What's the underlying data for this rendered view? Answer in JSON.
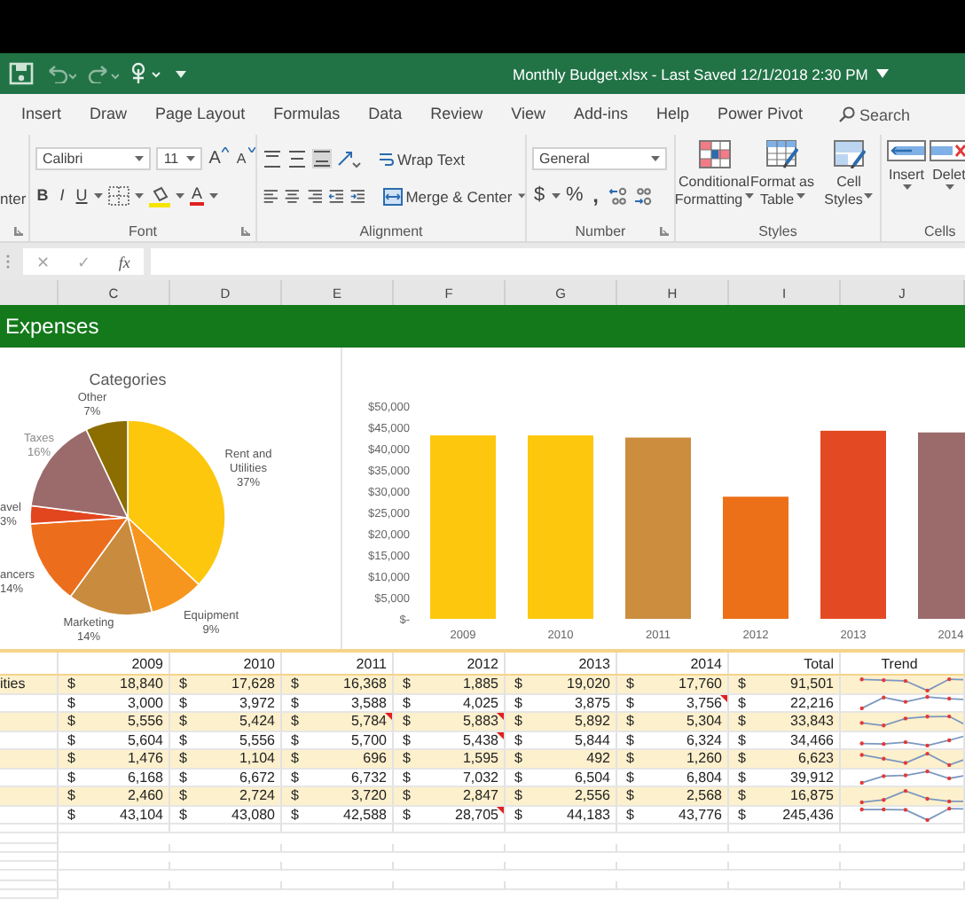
{
  "title_bar": {
    "title": "Monthly Budget.xlsx - Last Saved 12/1/2018 2:30 PM"
  },
  "tabs": [
    {
      "label": "Insert",
      "selected": false
    },
    {
      "label": "Draw",
      "selected": false
    },
    {
      "label": "Page Layout",
      "selected": false
    },
    {
      "label": "Formulas",
      "selected": false
    },
    {
      "label": "Data",
      "selected": false
    },
    {
      "label": "Review",
      "selected": false
    },
    {
      "label": "View",
      "selected": false
    },
    {
      "label": "Add-ins",
      "selected": false
    },
    {
      "label": "Help",
      "selected": false
    },
    {
      "label": "Power Pivot",
      "selected": false
    }
  ],
  "search": {
    "placeholder": "Search"
  },
  "ribbon": {
    "clipped_label": "nter",
    "font": {
      "name": "Calibri",
      "size": "11",
      "grow": "A",
      "shrink": "A",
      "bold": "B",
      "italic": "I",
      "underline": "U",
      "font_color": "A",
      "group": "Font"
    },
    "alignment": {
      "wrap": "Wrap Text",
      "merge": "Merge & Center",
      "group": "Alignment"
    },
    "number": {
      "format": "General",
      "currency": "$",
      "percent": "%",
      "comma": ",",
      "group": "Number"
    },
    "styles": {
      "buttons": [
        {
          "lines": [
            "Conditional",
            "Formatting"
          ],
          "kind": "conditional"
        },
        {
          "lines": [
            "Format as",
            "Table"
          ],
          "kind": "table"
        },
        {
          "lines": [
            "Cell",
            "Styles"
          ],
          "kind": "cellstyles"
        }
      ],
      "group": "Styles"
    },
    "cells": {
      "buttons": [
        {
          "label": "Insert",
          "kind": "insert"
        },
        {
          "label": "Delet",
          "kind": "delete"
        }
      ],
      "group": "Cells"
    }
  },
  "formula_bar": {
    "cancel": "✕",
    "enter": "✓",
    "fx": "fx"
  },
  "column_headers": [
    "C",
    "D",
    "E",
    "F",
    "G",
    "H",
    "I",
    "J"
  ],
  "banner": {
    "title": "Expenses"
  },
  "pie_chart": {
    "chart_data": {
      "type": "pie",
      "title": "Categories",
      "categories": [
        "Rent and Utilities",
        "Equipment",
        "Marketing",
        "ancers",
        "avel",
        "Taxes",
        "Other"
      ],
      "values": [
        37,
        9,
        14,
        14,
        3,
        16,
        7
      ],
      "colors": [
        "#fdc70d",
        "#f7961e",
        "#c98c3e",
        "#ec6e1c",
        "#e2461f",
        "#9b6b6b",
        "#8c6d00"
      ],
      "value_labels": [
        "37%",
        "9%",
        "14%",
        "14%",
        "3%",
        "16%",
        "7%"
      ],
      "data_labels": true
    }
  },
  "bar_chart": {
    "chart_data": {
      "type": "bar",
      "categories": [
        "2009",
        "2010",
        "2011",
        "2012",
        "2013",
        "2014"
      ],
      "values": [
        43100,
        43100,
        42600,
        28700,
        44200,
        43800
      ],
      "colors": [
        "#fdc70d",
        "#fdc70d",
        "#cc8d3f",
        "#ec7018",
        "#e34a24",
        "#9b6b6b"
      ],
      "ylim": [
        0,
        50000
      ],
      "yticks": [
        {
          "value": 0,
          "label": "$-"
        },
        {
          "value": 5000,
          "label": "$5,000"
        },
        {
          "value": 10000,
          "label": "$10,000"
        },
        {
          "value": 15000,
          "label": "$15,000"
        },
        {
          "value": 20000,
          "label": "$20,000"
        },
        {
          "value": 25000,
          "label": "$25,000"
        },
        {
          "value": 30000,
          "label": "$30,000"
        },
        {
          "value": 35000,
          "label": "$35,000"
        },
        {
          "value": 40000,
          "label": "$40,000"
        },
        {
          "value": 45000,
          "label": "$45,000"
        },
        {
          "value": 50000,
          "label": "$50,000"
        }
      ]
    }
  },
  "table": {
    "columns": [
      "2009",
      "2010",
      "2011",
      "2012",
      "2013",
      "2014",
      "Total",
      "Trend"
    ],
    "rows": [
      {
        "label": "ities",
        "cells": [
          {
            "symbol": "$",
            "text": "18,840",
            "comment": false
          },
          {
            "symbol": "$",
            "text": "17,628",
            "comment": false
          },
          {
            "symbol": "$",
            "text": "16,368",
            "comment": false
          },
          {
            "symbol": "$",
            "text": "1,885",
            "comment": false
          },
          {
            "symbol": "$",
            "text": "19,020",
            "comment": false
          },
          {
            "symbol": "$",
            "text": "17,760",
            "comment": false
          }
        ],
        "total": {
          "symbol": "$",
          "text": "91,501"
        }
      },
      {
        "cells": [
          {
            "symbol": "$",
            "text": "3,000",
            "comment": false
          },
          {
            "symbol": "$",
            "text": "3,972",
            "comment": false
          },
          {
            "symbol": "$",
            "text": "3,588",
            "comment": false
          },
          {
            "symbol": "$",
            "text": "4,025",
            "comment": false
          },
          {
            "symbol": "$",
            "text": "3,875",
            "comment": false
          },
          {
            "symbol": "$",
            "text": "3,756",
            "comment": true
          }
        ],
        "total": {
          "symbol": "$",
          "text": "22,216"
        }
      },
      {
        "cells": [
          {
            "symbol": "$",
            "text": "5,556",
            "comment": false
          },
          {
            "symbol": "$",
            "text": "5,424",
            "comment": false
          },
          {
            "symbol": "$",
            "text": "5,784",
            "comment": true
          },
          {
            "symbol": "$",
            "text": "5,883",
            "comment": true
          },
          {
            "symbol": "$",
            "text": "5,892",
            "comment": false
          },
          {
            "symbol": "$",
            "text": "5,304",
            "comment": false
          }
        ],
        "total": {
          "symbol": "$",
          "text": "33,843"
        }
      },
      {
        "cells": [
          {
            "symbol": "$",
            "text": "5,604",
            "comment": false
          },
          {
            "symbol": "$",
            "text": "5,556",
            "comment": false
          },
          {
            "symbol": "$",
            "text": "5,700",
            "comment": false
          },
          {
            "symbol": "$",
            "text": "5,438",
            "comment": true
          },
          {
            "symbol": "$",
            "text": "5,844",
            "comment": false
          },
          {
            "symbol": "$",
            "text": "6,324",
            "comment": false
          }
        ],
        "total": {
          "symbol": "$",
          "text": "34,466"
        }
      },
      {
        "cells": [
          {
            "symbol": "$",
            "text": "1,476",
            "comment": false
          },
          {
            "symbol": "$",
            "text": "1,104",
            "comment": false
          },
          {
            "symbol": "$",
            "text": "696",
            "comment": false
          },
          {
            "symbol": "$",
            "text": "1,595",
            "comment": false
          },
          {
            "symbol": "$",
            "text": "492",
            "comment": false
          },
          {
            "symbol": "$",
            "text": "1,260",
            "comment": false
          }
        ],
        "total": {
          "symbol": "$",
          "text": "6,623"
        }
      },
      {
        "cells": [
          {
            "symbol": "$",
            "text": "6,168",
            "comment": false
          },
          {
            "symbol": "$",
            "text": "6,672",
            "comment": false
          },
          {
            "symbol": "$",
            "text": "6,732",
            "comment": false
          },
          {
            "symbol": "$",
            "text": "7,032",
            "comment": false
          },
          {
            "symbol": "$",
            "text": "6,504",
            "comment": false
          },
          {
            "symbol": "$",
            "text": "6,804",
            "comment": false
          }
        ],
        "total": {
          "symbol": "$",
          "text": "39,912"
        }
      },
      {
        "cells": [
          {
            "symbol": "$",
            "text": "2,460",
            "comment": false
          },
          {
            "symbol": "$",
            "text": "2,724",
            "comment": false
          },
          {
            "symbol": "$",
            "text": "3,720",
            "comment": false
          },
          {
            "symbol": "$",
            "text": "2,847",
            "comment": false
          },
          {
            "symbol": "$",
            "text": "2,556",
            "comment": false
          },
          {
            "symbol": "$",
            "text": "2,568",
            "comment": false
          }
        ],
        "total": {
          "symbol": "$",
          "text": "16,875"
        }
      },
      {
        "cells": [
          {
            "symbol": "$",
            "text": "43,104",
            "comment": false
          },
          {
            "symbol": "$",
            "text": "43,080",
            "comment": false
          },
          {
            "symbol": "$",
            "text": "42,588",
            "comment": false
          },
          {
            "symbol": "$",
            "text": "28,705",
            "comment": true
          },
          {
            "symbol": "$",
            "text": "44,183",
            "comment": false
          },
          {
            "symbol": "$",
            "text": "43,776",
            "comment": false
          }
        ],
        "total": {
          "symbol": "$",
          "text": "245,436"
        }
      }
    ]
  }
}
